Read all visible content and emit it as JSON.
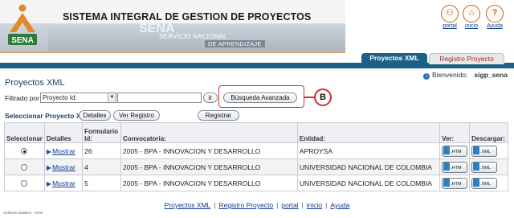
{
  "header": {
    "logo_text": "SENA",
    "system_title": "SISTEMA INTEGRAL DE GESTION DE PROYECTOS",
    "watermark_text": "SENA",
    "subtitle_line1": "SERVICIO NACIONAL",
    "subtitle_line2": "DE APRENDIZAJE",
    "links": [
      {
        "label": "portal",
        "icon": "portal-icon"
      },
      {
        "label": "inicio",
        "icon": "home-icon"
      },
      {
        "label": "Ayuda",
        "icon": "help-icon"
      }
    ]
  },
  "tabs": [
    {
      "label": "Proyectos XML",
      "active": true
    },
    {
      "label": "Registro Proyecto",
      "active": false
    }
  ],
  "welcome": {
    "label": "Bienvenido:",
    "user": "sigp_sena"
  },
  "page_title": "Proyectos XML",
  "filter": {
    "label": "Filtrado por",
    "selected": "Proyecto Id:",
    "input_value": "",
    "go_label": "Ir",
    "advanced_label": "Búsqueda Avanzada"
  },
  "callout": {
    "letter": "B",
    "color": "#d43030"
  },
  "actions": {
    "label": "Seleccionar Proyecto XML",
    "detalles_label": "Detalles",
    "ver_registro_label": "Ver Registro",
    "registrar_label": "Registrar"
  },
  "table": {
    "headers": [
      "Seleccionar",
      "Detalles",
      "Formulario Id:",
      "Convocatoria:",
      "Entidad:",
      "Ver:",
      "Descargar:"
    ],
    "rows": [
      {
        "selected": true,
        "detail_link": "Mostrar",
        "form_id": "26",
        "convocatoria": "2005 - BPA - INNOVACION Y DESARROLLO",
        "entidad": "APROYSA",
        "ver": ".HTM",
        "descargar": ".XML"
      },
      {
        "selected": false,
        "detail_link": "Mostrar",
        "form_id": "4",
        "convocatoria": "2005 - BPA - INNOVACION Y DESARROLLO",
        "entidad": "UNIVERSIDAD NACIONAL DE COLOMBIA",
        "ver": ".HTM",
        "descargar": ".XML"
      },
      {
        "selected": false,
        "detail_link": "Mostrar",
        "form_id": "5",
        "convocatoria": "2005 - BPA - INNOVACION Y DESARROLLO",
        "entidad": "UNIVERSIDAD NACIONAL DE COLOMBIA",
        "ver": ".HTM",
        "descargar": ".XML"
      }
    ]
  },
  "footer": {
    "links": [
      "Proyectos XML",
      "Registro Proyecto",
      "portal",
      "inicio",
      "Ayuda"
    ],
    "credit": "Software Builders - 2006"
  },
  "colors": {
    "accent": "#1a6087",
    "brand_orange": "#e8a36b",
    "link": "#0b3a8f"
  }
}
